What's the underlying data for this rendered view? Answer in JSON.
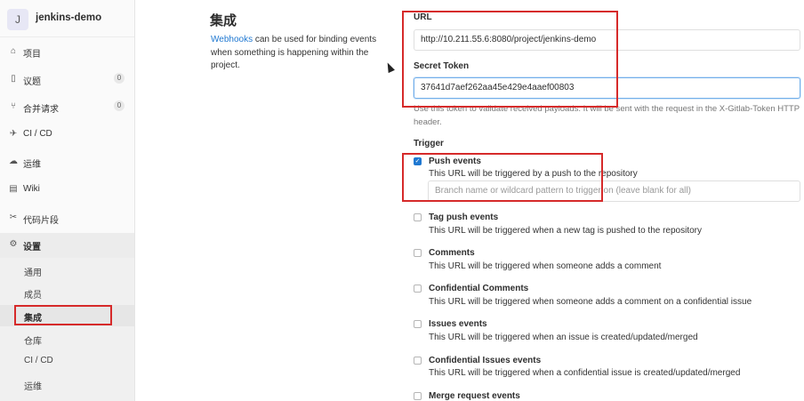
{
  "project": {
    "avatar_letter": "J",
    "name": "jenkins-demo"
  },
  "sidebar": {
    "items": [
      {
        "label": "项目",
        "icon": "home-icon",
        "glyph": "⌂"
      },
      {
        "label": "议题",
        "icon": "issues-icon",
        "glyph": "▯",
        "count": "0"
      },
      {
        "label": "合并请求",
        "icon": "merge-request-icon",
        "glyph": "⑂",
        "count": "0"
      },
      {
        "label": "CI / CD",
        "icon": "rocket-icon",
        "glyph": "✈"
      },
      {
        "label": "运维",
        "icon": "cloud-gear-icon",
        "glyph": "☁"
      },
      {
        "label": "Wiki",
        "icon": "book-icon",
        "glyph": "▤"
      },
      {
        "label": "代码片段",
        "icon": "scissors-icon",
        "glyph": "✂"
      },
      {
        "label": "设置",
        "icon": "gear-icon",
        "glyph": "⚙"
      }
    ],
    "sub_items": [
      "通用",
      "成员",
      "集成",
      "仓库",
      "CI / CD",
      "运维"
    ]
  },
  "main": {
    "title": "集成",
    "desc_link": "Webhooks",
    "desc_text": " can be used for binding events when something is happening within the project."
  },
  "form": {
    "url_label": "URL",
    "url_value": "http://10.211.55.6:8080/project/jenkins-demo",
    "token_label": "Secret Token",
    "token_value": "37641d7aef262aa45e429e4aaef00803",
    "token_help": "Use this token to validate received payloads. It will be sent with the request in the X-Gitlab-Token HTTP header.",
    "trigger_label": "Trigger",
    "branch_placeholder": "Branch name or wildcard pattern to trigger on (leave blank for all)"
  },
  "triggers": [
    {
      "title": "Push events",
      "desc": "This URL will be triggered by a push to the repository",
      "checked": true
    },
    {
      "title": "Tag push events",
      "desc": "This URL will be triggered when a new tag is pushed to the repository",
      "checked": false
    },
    {
      "title": "Comments",
      "desc": "This URL will be triggered when someone adds a comment",
      "checked": false
    },
    {
      "title": "Confidential Comments",
      "desc": "This URL will be triggered when someone adds a comment on a confidential issue",
      "checked": false
    },
    {
      "title": "Issues events",
      "desc": "This URL will be triggered when an issue is created/updated/merged",
      "checked": false
    },
    {
      "title": "Confidential Issues events",
      "desc": "This URL will be triggered when a confidential issue is created/updated/merged",
      "checked": false
    },
    {
      "title": "Merge request events",
      "desc": "",
      "checked": false
    }
  ],
  "colors": {
    "highlight": "#d62a2a",
    "accent": "#1f78d1"
  }
}
